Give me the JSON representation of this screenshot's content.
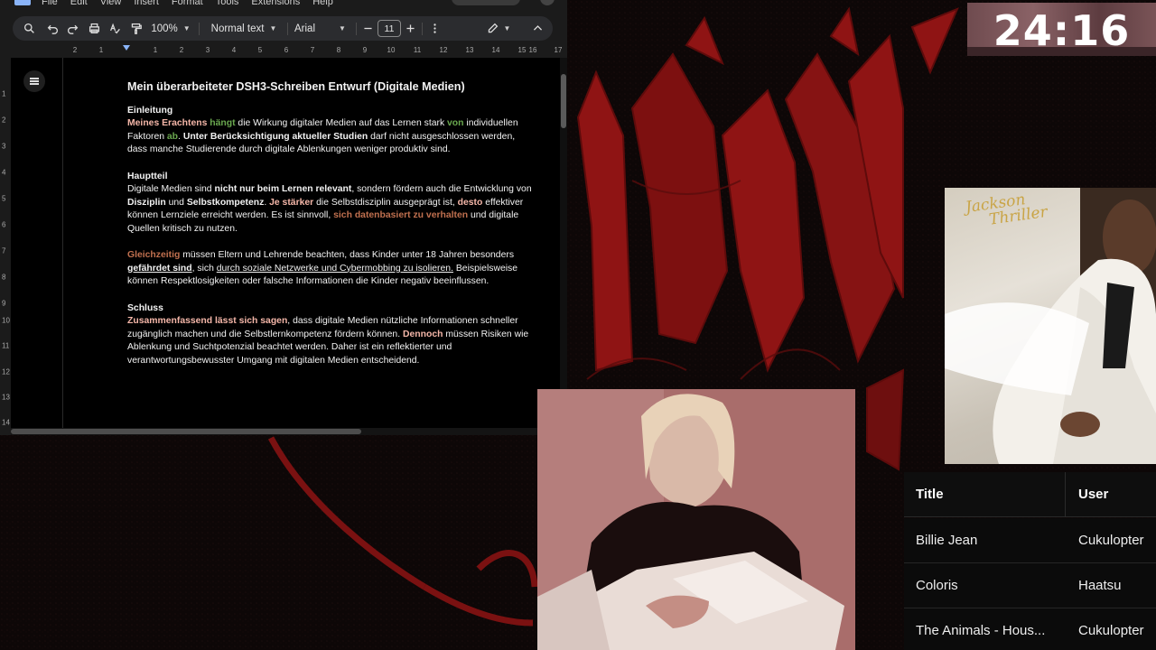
{
  "docs": {
    "menu": [
      "File",
      "Edit",
      "View",
      "Insert",
      "Format",
      "Tools",
      "Extensions",
      "Help"
    ],
    "toolbar": {
      "zoom": "100%",
      "style": "Normal text",
      "font": "Arial",
      "font_size": "11",
      "icons": [
        "search-icon",
        "undo-icon",
        "redo-icon",
        "print-icon",
        "spellcheck-icon",
        "paint-format-icon",
        "minus-icon",
        "plus-icon",
        "more-icon",
        "edit-mode-icon",
        "collapse-icon"
      ]
    },
    "ruler_ticks": [
      "2",
      "1",
      "1",
      "2",
      "3",
      "4",
      "5",
      "6",
      "7",
      "8",
      "9",
      "10",
      "11",
      "12",
      "13",
      "14",
      "15",
      "16",
      "17"
    ],
    "vruler_ticks": [
      "1",
      "2",
      "3",
      "4",
      "5",
      "6",
      "7",
      "8",
      "9",
      "10",
      "11",
      "12",
      "13",
      "14"
    ],
    "document": {
      "title": "Mein überarbeiteter DSH3-Schreiben Entwurf (Digitale Medien)",
      "intro_heading": "Einleitung",
      "intro": {
        "s1": "Meines Erachtens",
        "s2": "hängt",
        "s3": "die Wirkung digitaler Medien auf das Lernen stark",
        "s4": "von",
        "s5": "individuellen Faktoren",
        "s6": "ab",
        "s7": ".",
        "s8": "Unter Berücksichtigung aktueller Studien",
        "s9": "darf nicht ausgeschlossen werden, dass manche Studierende durch digitale Ablenkungen weniger produktiv sind."
      },
      "main_heading": "Hauptteil",
      "main1": {
        "s1": "Digitale Medien sind",
        "s2": "nicht nur beim Lernen relevant",
        "s3": ", sondern fördern auch die Entwicklung von",
        "s4": "Disziplin",
        "s5": "und",
        "s6": "Selbstkompetenz",
        "s7": ".",
        "s8": "Je stärker",
        "s9": "die Selbstdisziplin ausgeprägt ist,",
        "s10": "desto",
        "s11": "effektiver können Lernziele erreicht werden. Es ist sinnvoll,",
        "s12": "sich datenbasiert zu verhalten",
        "s13": "und digitale Quellen kritisch zu nutzen."
      },
      "main2": {
        "s1": "Gleichzeitig",
        "s2": "müssen Eltern und Lehrende beachten, dass Kinder unter 18 Jahren besonders",
        "s3": "gefährdet sind",
        "s4": ", sich",
        "s5": "durch soziale Netzwerke und Cybermobbing zu isolieren.",
        "s6": "Beispielsweise können Respektlosigkeiten oder falsche Informationen die Kinder negativ beeinflussen."
      },
      "end_heading": "Schluss",
      "end": {
        "s1": "Zusammenfassend lässt sich sagen",
        "s2": ", dass digitale Medien nützliche Informationen schneller zugänglich machen und die Selbstlernkompetenz fördern können.",
        "s3": "Dennoch",
        "s4": "müssen Risiken wie Ablenkung und Suchtpotenzial beachtet werden. Daher ist ein reflektierter und verantwortungsbewusster Umgang mit digitalen Medien entscheidend."
      }
    }
  },
  "timer": "24:16",
  "album": {
    "artist_script": "Jackson",
    "title_script": "Thriller"
  },
  "queue": {
    "headers": {
      "title": "Title",
      "user": "User"
    },
    "rows": [
      {
        "title": "Billie Jean",
        "user": "Cukulopter"
      },
      {
        "title": "Coloris",
        "user": "Haatsu"
      },
      {
        "title": "The Animals - Hous...",
        "user": "Cukulopter"
      }
    ]
  },
  "colors": {
    "background": "#0b0606",
    "art_red": "#8f1414",
    "docs_toolbar": "#2b2c2f",
    "accent_green": "#6aa84f",
    "accent_red": "#e06666"
  }
}
